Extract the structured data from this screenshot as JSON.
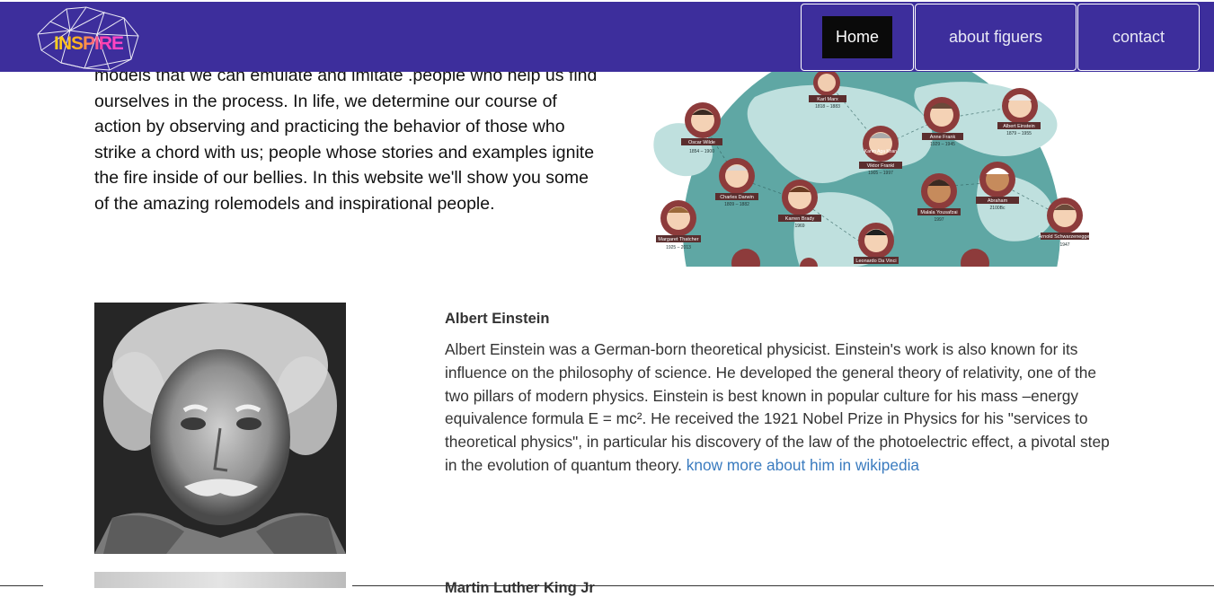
{
  "logo": {
    "text": "INSPIRE",
    "icon": "crystal-outline-logo"
  },
  "nav": {
    "home": "Home",
    "about": "about figuers",
    "contact": "contact"
  },
  "intro": {
    "text": "models that we can emulate and imitate .people who help us find ourselves in the process. In life, we determine our course of action by observing and practicing the behavior of those who strike a chord with us; people whose stories and examples ignite the fire inside of our bellies. In this website we'll show you some of the amazing rolemodels and inspirational people."
  },
  "map": {
    "labels": [
      "Karl Marx",
      "Anne Frank",
      "Albert Einstein",
      "Oscar Wilde",
      "Viktor Frankl",
      "Karim Aga Khan",
      "Charles Darwin",
      "Karren Brady",
      "Malala Yousafzai",
      "Abraham",
      "Margaret Thatcher",
      "Leonardo Da Vinci",
      "Arnold Schwarzenegger"
    ],
    "years": [
      "1818 – 1883",
      "1929 – 1945",
      "1879 – 1955",
      "1854 – 1900",
      "1905 – 1997",
      "1809 – 1882",
      "1969",
      "1997",
      "2100Bc",
      "1925 – 2013",
      "1947"
    ]
  },
  "figures": [
    {
      "name": "Albert Einstein",
      "bio": "Albert Einstein was a German-born theoretical physicist. Einstein's work is also known for its influence on the philosophy of science. He developed the general theory of relativity, one of the two pillars of modern physics. Einstein is best known in popular culture for his mass –energy equivalence formula E = mc². He received the 1921 Nobel Prize in Physics for his \"services to theoretical physics\", in particular his discovery of the law of the photoelectric effect, a pivotal step in the evolution of quantum theory.",
      "link": "know more about him in wikipedia"
    },
    {
      "name": "Martin Luther King Jr"
    }
  ],
  "colors": {
    "navbar": "#3d2e9c",
    "link": "#3a7bbf",
    "map_ocean": "#5fa7a4"
  }
}
